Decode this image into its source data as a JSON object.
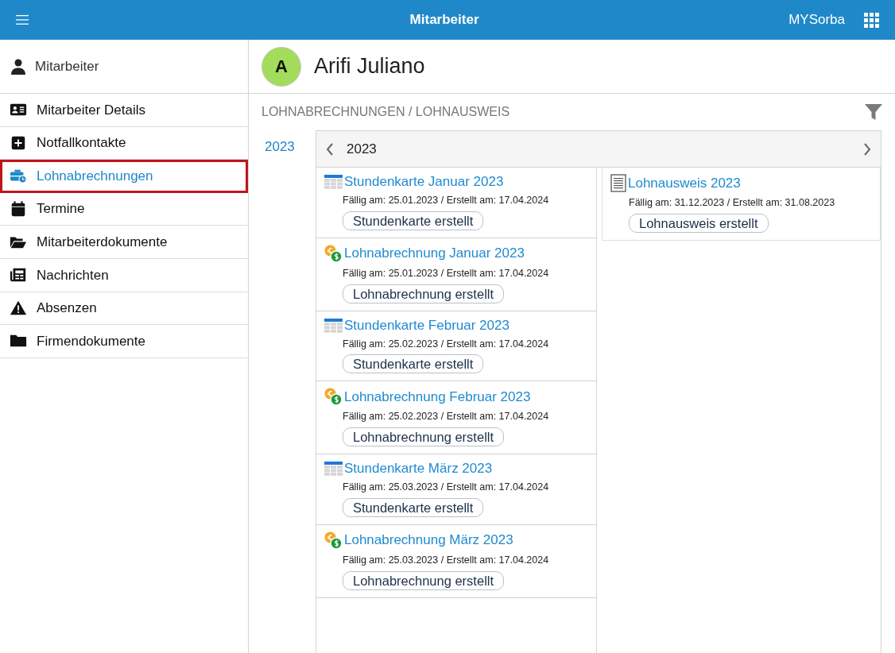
{
  "header": {
    "title": "Mitarbeiter",
    "brand": "MYSorba"
  },
  "sidebar": {
    "profile": {
      "label": "Mitarbeiter"
    },
    "items": [
      {
        "label": "Mitarbeiter Details",
        "kind": "idcard",
        "selected": false
      },
      {
        "label": "Notfallkontakte",
        "kind": "plus",
        "selected": false
      },
      {
        "label": "Lohnabrechnungen",
        "kind": "briefcase",
        "selected": true
      },
      {
        "label": "Termine",
        "kind": "calendar",
        "selected": false
      },
      {
        "label": "Mitarbeiterdokumente",
        "kind": "folder-open",
        "selected": false
      },
      {
        "label": "Nachrichten",
        "kind": "newspaper",
        "selected": false
      },
      {
        "label": "Absenzen",
        "kind": "warning",
        "selected": false
      },
      {
        "label": "Firmendokumente",
        "kind": "folder",
        "selected": false
      }
    ]
  },
  "employee": {
    "initial": "A",
    "name": "Arifi Juliano"
  },
  "section": {
    "title": "LOHNABRECHNUNGEN / LOHNAUSWEIS"
  },
  "years": [
    {
      "label": "2023",
      "selected": true
    }
  ],
  "panel": {
    "year": "2023",
    "columns": [
      [
        {
          "kind": "timesheet",
          "title": "Stundenkarte Januar 2023",
          "dates": "Fällig am: 25.01.2023 / Erstellt am: 17.04.2024",
          "status": "Stundenkarte erstellt"
        },
        {
          "kind": "payslip",
          "title": "Lohnabrechnung Januar 2023",
          "dates": "Fällig am: 25.01.2023 / Erstellt am: 17.04.2024",
          "status": "Lohnabrechnung erstellt"
        },
        {
          "kind": "timesheet",
          "title": "Stundenkarte Februar 2023",
          "dates": "Fällig am: 25.02.2023 / Erstellt am: 17.04.2024",
          "status": "Stundenkarte erstellt"
        },
        {
          "kind": "payslip",
          "title": "Lohnabrechnung Februar 2023",
          "dates": "Fällig am: 25.02.2023 / Erstellt am: 17.04.2024",
          "status": "Lohnabrechnung erstellt"
        },
        {
          "kind": "timesheet",
          "title": "Stundenkarte März 2023",
          "dates": "Fällig am: 25.03.2023 / Erstellt am: 17.04.2024",
          "status": "Stundenkarte erstellt"
        },
        {
          "kind": "payslip",
          "title": "Lohnabrechnung März 2023",
          "dates": "Fällig am: 25.03.2023 / Erstellt am: 17.04.2024",
          "status": "Lohnabrechnung erstellt"
        }
      ],
      [
        {
          "kind": "certificate",
          "title": "Lohnausweis 2023",
          "dates": "Fällig am: 31.12.2023 / Erstellt am: 31.08.2023",
          "status": "Lohnausweis erstellt"
        }
      ]
    ]
  }
}
